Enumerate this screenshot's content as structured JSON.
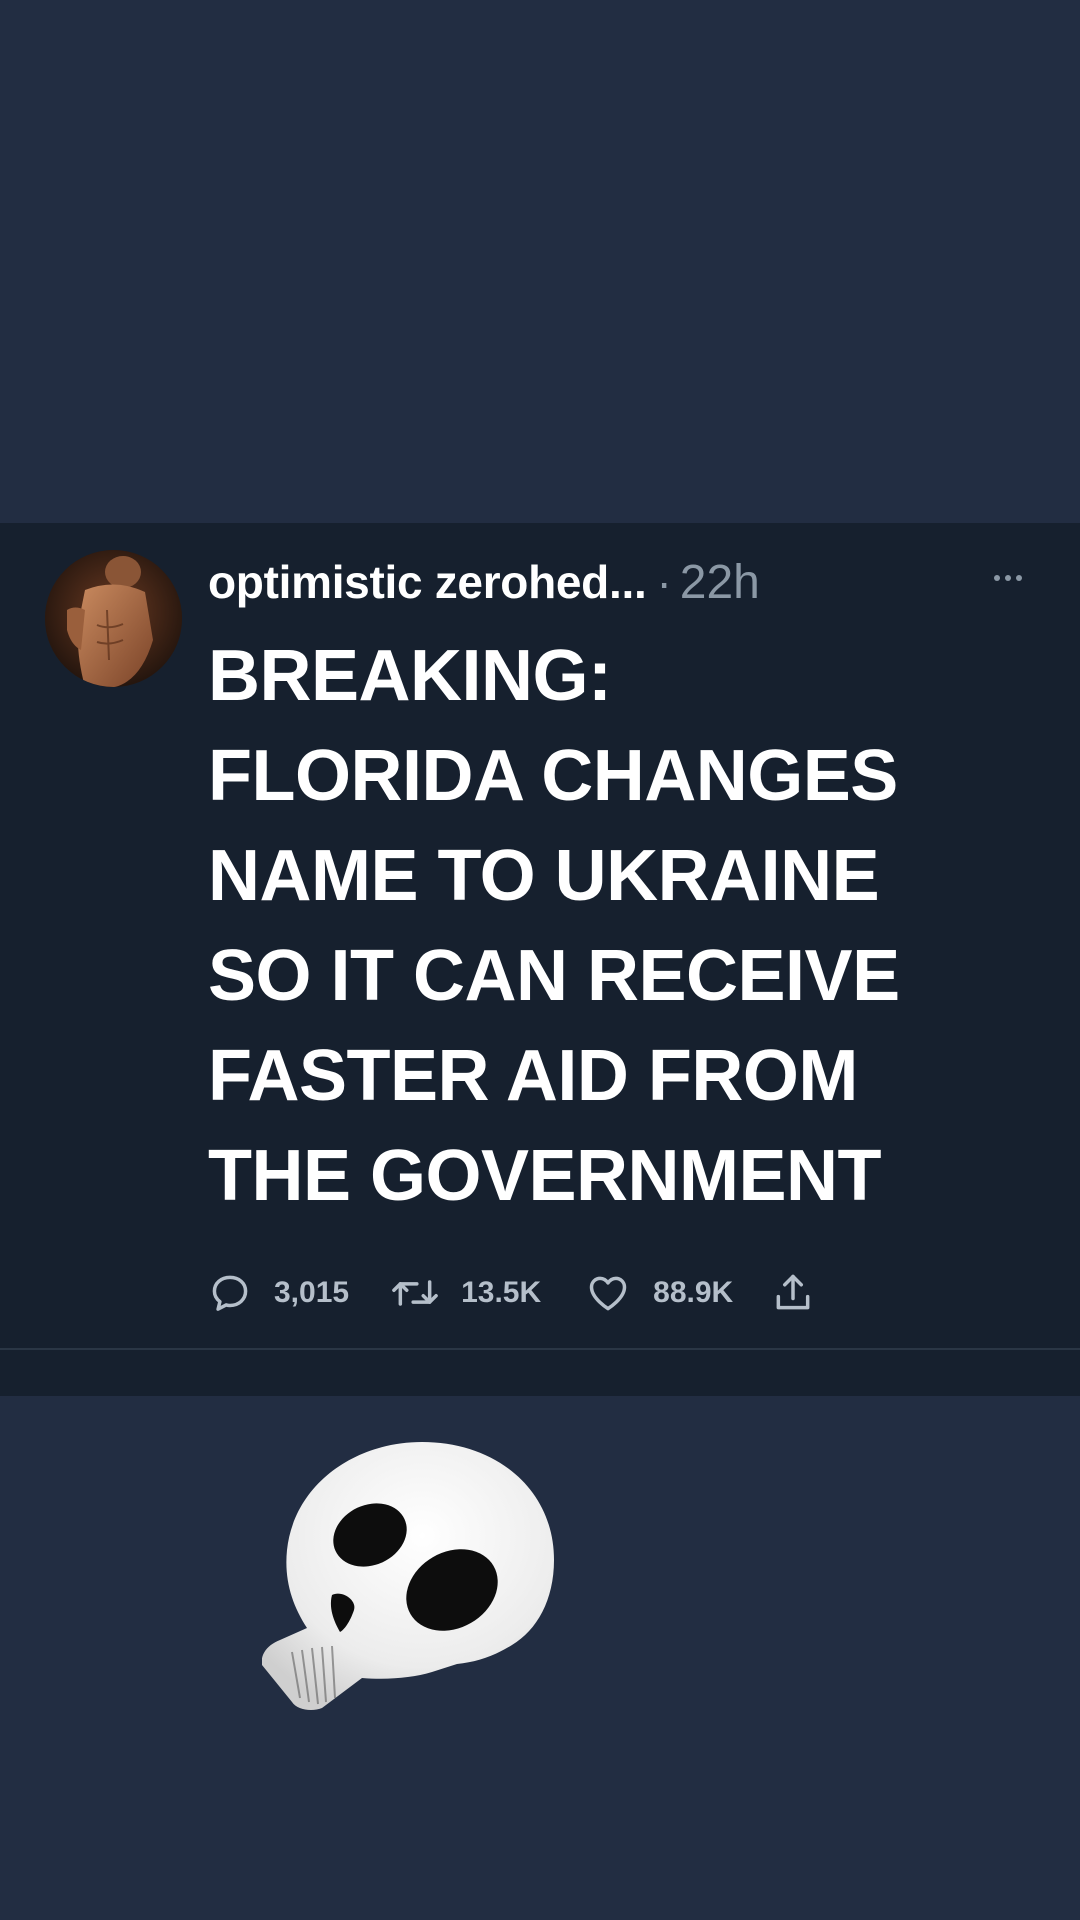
{
  "tweet": {
    "display_name": "optimistic zerohed...",
    "separator": "·",
    "timestamp": "22h",
    "text": "BREAKING:\nFLORIDA CHANGES\nNAME TO UKRAINE\nSO IT CAN RECEIVE\nFASTER AID FROM\nTHE GOVERNMENT",
    "actions": {
      "replies": "3,015",
      "retweets": "13.5K",
      "likes": "88.9K"
    }
  },
  "icons": {
    "avatar": "avatar",
    "more": "more-horizontal-icon",
    "reply": "reply-icon",
    "retweet": "retweet-icon",
    "like": "heart-icon",
    "share": "share-icon",
    "emoji": "skull-emoji-icon"
  },
  "colors": {
    "page_background": "#222d42",
    "card_background": "#16202e",
    "text_primary": "#ffffff",
    "text_secondary": "#8b98a5"
  }
}
